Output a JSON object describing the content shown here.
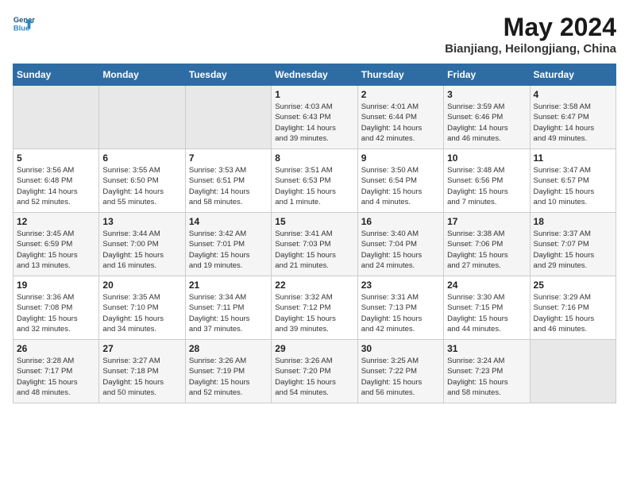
{
  "logo": {
    "line1": "General",
    "line2": "Blue"
  },
  "title": "May 2024",
  "location": "Bianjiang, Heilongjiang, China",
  "days_of_week": [
    "Sunday",
    "Monday",
    "Tuesday",
    "Wednesday",
    "Thursday",
    "Friday",
    "Saturday"
  ],
  "weeks": [
    [
      {
        "day": "",
        "info": ""
      },
      {
        "day": "",
        "info": ""
      },
      {
        "day": "",
        "info": ""
      },
      {
        "day": "1",
        "info": "Sunrise: 4:03 AM\nSunset: 6:43 PM\nDaylight: 14 hours\nand 39 minutes."
      },
      {
        "day": "2",
        "info": "Sunrise: 4:01 AM\nSunset: 6:44 PM\nDaylight: 14 hours\nand 42 minutes."
      },
      {
        "day": "3",
        "info": "Sunrise: 3:59 AM\nSunset: 6:46 PM\nDaylight: 14 hours\nand 46 minutes."
      },
      {
        "day": "4",
        "info": "Sunrise: 3:58 AM\nSunset: 6:47 PM\nDaylight: 14 hours\nand 49 minutes."
      }
    ],
    [
      {
        "day": "5",
        "info": "Sunrise: 3:56 AM\nSunset: 6:48 PM\nDaylight: 14 hours\nand 52 minutes."
      },
      {
        "day": "6",
        "info": "Sunrise: 3:55 AM\nSunset: 6:50 PM\nDaylight: 14 hours\nand 55 minutes."
      },
      {
        "day": "7",
        "info": "Sunrise: 3:53 AM\nSunset: 6:51 PM\nDaylight: 14 hours\nand 58 minutes."
      },
      {
        "day": "8",
        "info": "Sunrise: 3:51 AM\nSunset: 6:53 PM\nDaylight: 15 hours\nand 1 minute."
      },
      {
        "day": "9",
        "info": "Sunrise: 3:50 AM\nSunset: 6:54 PM\nDaylight: 15 hours\nand 4 minutes."
      },
      {
        "day": "10",
        "info": "Sunrise: 3:48 AM\nSunset: 6:56 PM\nDaylight: 15 hours\nand 7 minutes."
      },
      {
        "day": "11",
        "info": "Sunrise: 3:47 AM\nSunset: 6:57 PM\nDaylight: 15 hours\nand 10 minutes."
      }
    ],
    [
      {
        "day": "12",
        "info": "Sunrise: 3:45 AM\nSunset: 6:59 PM\nDaylight: 15 hours\nand 13 minutes."
      },
      {
        "day": "13",
        "info": "Sunrise: 3:44 AM\nSunset: 7:00 PM\nDaylight: 15 hours\nand 16 minutes."
      },
      {
        "day": "14",
        "info": "Sunrise: 3:42 AM\nSunset: 7:01 PM\nDaylight: 15 hours\nand 19 minutes."
      },
      {
        "day": "15",
        "info": "Sunrise: 3:41 AM\nSunset: 7:03 PM\nDaylight: 15 hours\nand 21 minutes."
      },
      {
        "day": "16",
        "info": "Sunrise: 3:40 AM\nSunset: 7:04 PM\nDaylight: 15 hours\nand 24 minutes."
      },
      {
        "day": "17",
        "info": "Sunrise: 3:38 AM\nSunset: 7:06 PM\nDaylight: 15 hours\nand 27 minutes."
      },
      {
        "day": "18",
        "info": "Sunrise: 3:37 AM\nSunset: 7:07 PM\nDaylight: 15 hours\nand 29 minutes."
      }
    ],
    [
      {
        "day": "19",
        "info": "Sunrise: 3:36 AM\nSunset: 7:08 PM\nDaylight: 15 hours\nand 32 minutes."
      },
      {
        "day": "20",
        "info": "Sunrise: 3:35 AM\nSunset: 7:10 PM\nDaylight: 15 hours\nand 34 minutes."
      },
      {
        "day": "21",
        "info": "Sunrise: 3:34 AM\nSunset: 7:11 PM\nDaylight: 15 hours\nand 37 minutes."
      },
      {
        "day": "22",
        "info": "Sunrise: 3:32 AM\nSunset: 7:12 PM\nDaylight: 15 hours\nand 39 minutes."
      },
      {
        "day": "23",
        "info": "Sunrise: 3:31 AM\nSunset: 7:13 PM\nDaylight: 15 hours\nand 42 minutes."
      },
      {
        "day": "24",
        "info": "Sunrise: 3:30 AM\nSunset: 7:15 PM\nDaylight: 15 hours\nand 44 minutes."
      },
      {
        "day": "25",
        "info": "Sunrise: 3:29 AM\nSunset: 7:16 PM\nDaylight: 15 hours\nand 46 minutes."
      }
    ],
    [
      {
        "day": "26",
        "info": "Sunrise: 3:28 AM\nSunset: 7:17 PM\nDaylight: 15 hours\nand 48 minutes."
      },
      {
        "day": "27",
        "info": "Sunrise: 3:27 AM\nSunset: 7:18 PM\nDaylight: 15 hours\nand 50 minutes."
      },
      {
        "day": "28",
        "info": "Sunrise: 3:26 AM\nSunset: 7:19 PM\nDaylight: 15 hours\nand 52 minutes."
      },
      {
        "day": "29",
        "info": "Sunrise: 3:26 AM\nSunset: 7:20 PM\nDaylight: 15 hours\nand 54 minutes."
      },
      {
        "day": "30",
        "info": "Sunrise: 3:25 AM\nSunset: 7:22 PM\nDaylight: 15 hours\nand 56 minutes."
      },
      {
        "day": "31",
        "info": "Sunrise: 3:24 AM\nSunset: 7:23 PM\nDaylight: 15 hours\nand 58 minutes."
      },
      {
        "day": "",
        "info": ""
      }
    ]
  ]
}
